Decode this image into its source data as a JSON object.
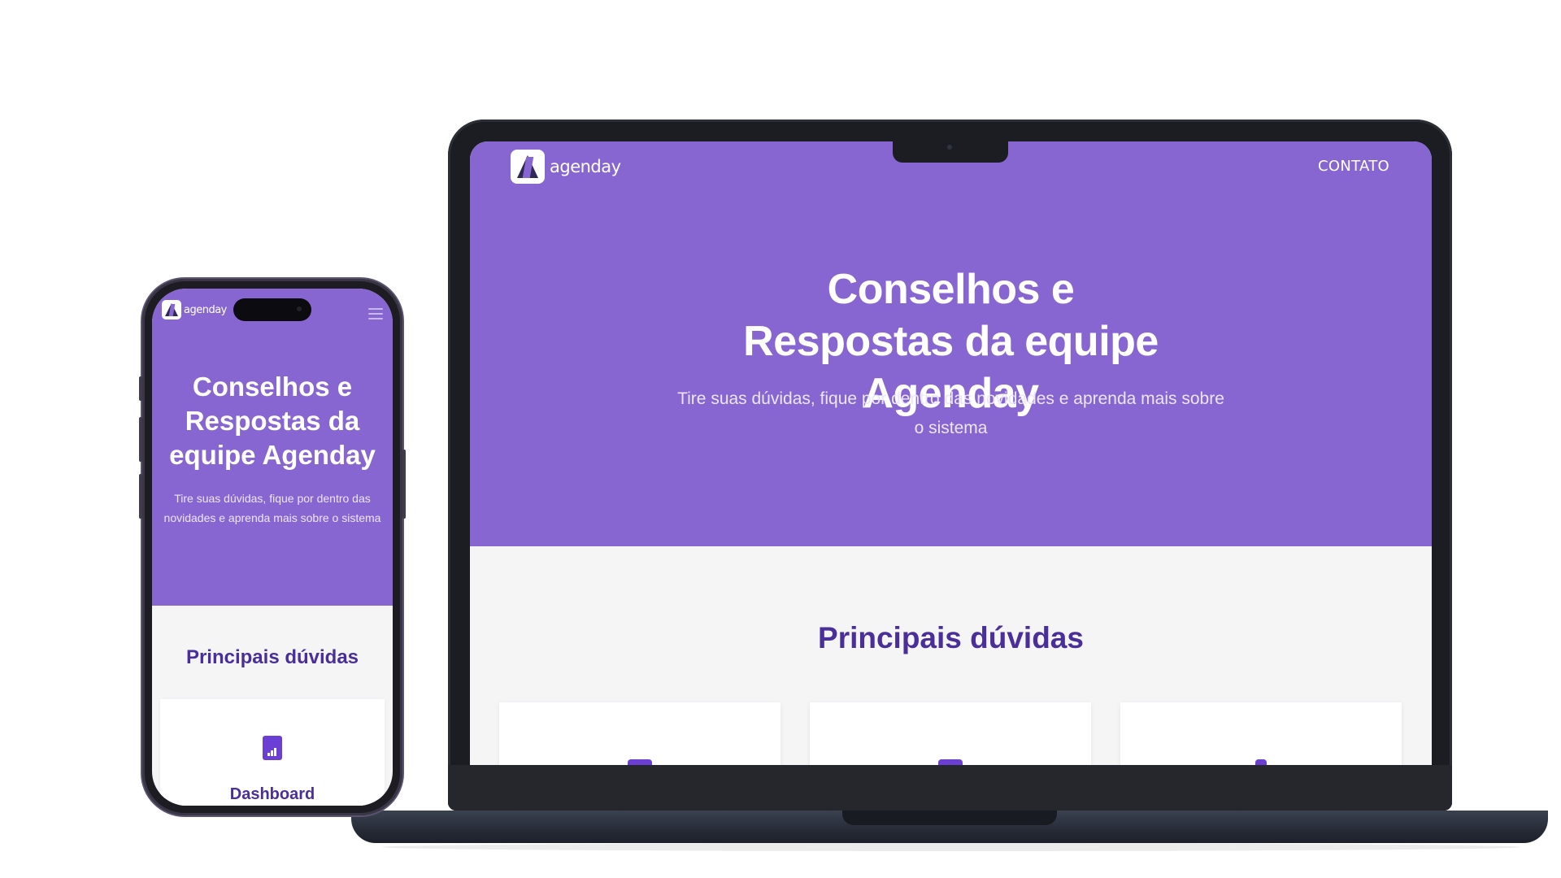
{
  "brand": {
    "name": "agenday",
    "primary_color": "#8766d1",
    "heading_color": "#4a2f9a"
  },
  "laptop": {
    "nav": {
      "logo_text": "agenday",
      "contact_label": "CONTATO"
    },
    "hero": {
      "title": "Conselhos e Respostas da equipe Agenday",
      "subtitle": "Tire suas dúvidas, fique por dentro das novidades e aprenda mais sobre o sistema"
    },
    "section_title": "Principais dúvidas"
  },
  "phone": {
    "nav": {
      "logo_text": "agenday",
      "menu_icon": "hamburger-icon"
    },
    "hero": {
      "title": "Conselhos e Respostas da equipe Agenday",
      "subtitle": "Tire suas dúvidas, fique por dentro das novidades e aprenda mais sobre o sistema"
    },
    "section_title": "Principais dúvidas",
    "card": {
      "icon": "document-chart-icon",
      "label": "Dashboard"
    }
  }
}
